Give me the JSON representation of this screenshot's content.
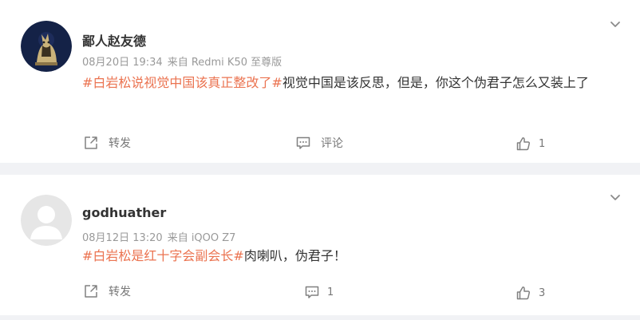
{
  "posts": [
    {
      "username": "鄙人赵友德",
      "date": "08月20日 19:34",
      "source": "来自 Redmi K50 至尊版",
      "hashtag": "#白岩松说视觉中国该真正整改了#",
      "text": "视觉中国是该反思，但是，你这个伪君子怎么又装上了",
      "actions": {
        "share_label": "转发",
        "comment_label": "评论",
        "like_count": "1"
      }
    },
    {
      "username": "godhuather",
      "date": "08月12日 13:20",
      "source": "来自 iQOO Z7",
      "hashtag": "#白岩松是红十字会副会长#",
      "text": "肉喇叭，伪君子！",
      "actions": {
        "share_label": "转发",
        "comment_count": "1",
        "like_count": "3"
      }
    }
  ],
  "colors": {
    "hashtag": "#eb7350",
    "meta_text": "#999999",
    "action_text": "#777777",
    "page_bg": "#f1f2f5"
  },
  "icons": {
    "options": "chevron-down-icon",
    "share": "share-icon",
    "comment": "comment-icon",
    "like": "thumbs-up-icon"
  }
}
